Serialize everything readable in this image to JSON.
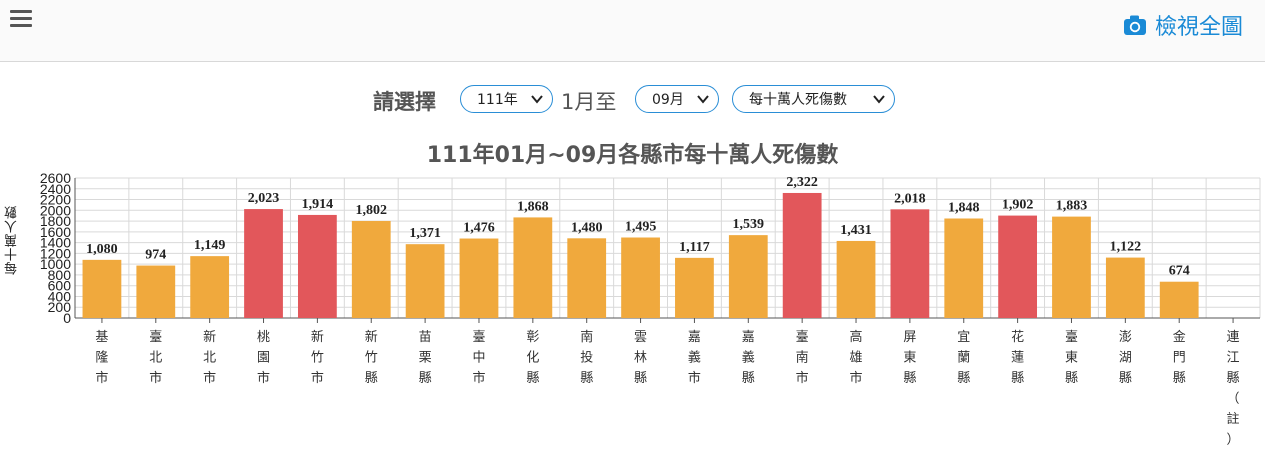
{
  "header": {
    "menu_icon": "hamburger-menu-icon",
    "view_all_icon": "camera-icon",
    "view_all_label": "檢視全圖",
    "accent_color": "#1a8ad6"
  },
  "filters": {
    "label": "請選擇",
    "year_value": "111年",
    "start_month_text": "1月至",
    "end_month_value": "09月",
    "metric_value": "每十萬人死傷數"
  },
  "chart_data": {
    "type": "bar",
    "title": "111年01月~09月各縣市每十萬人死傷數",
    "ylabel": "每十萬人數",
    "xlabel": "",
    "ylim": [
      0,
      2600
    ],
    "yticks": [
      0,
      200,
      400,
      600,
      800,
      1000,
      1200,
      1400,
      1600,
      1800,
      2000,
      2200,
      2400,
      2600
    ],
    "grid": true,
    "categories": [
      "基隆市",
      "臺北市",
      "新北市",
      "桃園市",
      "新竹市",
      "新竹縣",
      "苗栗縣",
      "臺中市",
      "彰化縣",
      "南投縣",
      "雲林縣",
      "嘉義市",
      "嘉義縣",
      "臺南市",
      "高雄市",
      "屏東縣",
      "宜蘭縣",
      "花蓮縣",
      "臺東縣",
      "澎湖縣",
      "金門縣",
      "連江縣（註）"
    ],
    "values": [
      1080,
      974,
      1149,
      2023,
      1914,
      1802,
      1371,
      1476,
      1868,
      1480,
      1495,
      1117,
      1539,
      2322,
      1431,
      2018,
      1848,
      1902,
      1883,
      1122,
      674,
      null
    ],
    "value_labels": [
      "1,080",
      "974",
      "1,149",
      "2,023",
      "1,914",
      "1,802",
      "1,371",
      "1,476",
      "1,868",
      "1,480",
      "1,495",
      "1,117",
      "1,539",
      "2,322",
      "1,431",
      "2,018",
      "1,848",
      "1,902",
      "1,883",
      "1,122",
      "674",
      ""
    ],
    "highlight": [
      false,
      false,
      false,
      true,
      true,
      false,
      false,
      false,
      false,
      false,
      false,
      false,
      false,
      true,
      false,
      true,
      false,
      true,
      false,
      false,
      false,
      false
    ],
    "colors": {
      "normal": "#f0a93d",
      "highlight": "#e2575b"
    }
  }
}
